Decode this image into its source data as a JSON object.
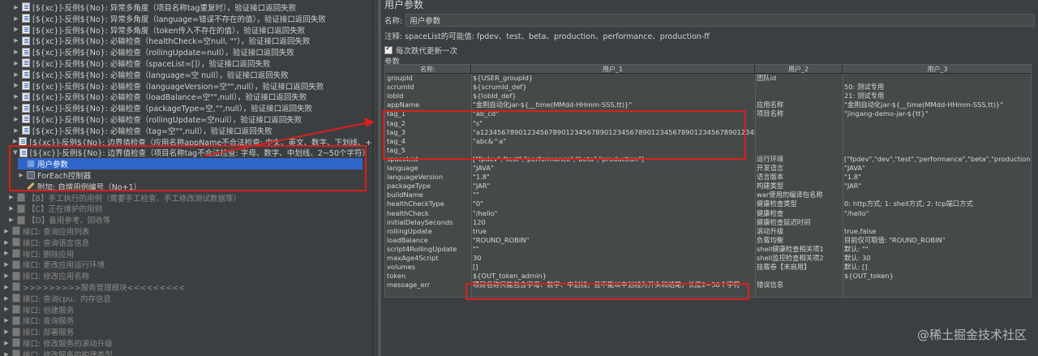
{
  "tree": {
    "items": [
      {
        "text": "[${xc}]-反例${No}: 异常多角度（项目名称tag重复时），验证接口返回失败",
        "kind": "case",
        "disabled": false
      },
      {
        "text": "[${xc}]-反例${No}: 异常多角度（language=错误不存在的值），验证接口返回失败",
        "kind": "case",
        "disabled": false
      },
      {
        "text": "[${xc}]-反例${No}: 异常多角度（token传入不存在的值），验证接口返回失败",
        "kind": "case",
        "disabled": false
      },
      {
        "text": "[${xc}]-反例${No}: 必输检查（healthCheck=空null, \"\"），验证接口返回失败",
        "kind": "case",
        "disabled": false
      },
      {
        "text": "[${xc}]-反例${No}: 必输检查（rollingUpdate=null），验证接口返回失败",
        "kind": "case",
        "disabled": false
      },
      {
        "text": "[${xc}]-反例${No}: 必输检查（spaceList=[]），验证接口返回失败",
        "kind": "case",
        "disabled": false
      },
      {
        "text": "[${xc}]-反例${No}: 必输检查（language=空 null），验证接口返回失败",
        "kind": "case",
        "disabled": false
      },
      {
        "text": "[${xc}]-反例${No}: 必输检查（languageVersion=空\"\",null），验证接口返回失败",
        "kind": "case",
        "disabled": false
      },
      {
        "text": "[${xc}]-反例${No}: 必输检查（loadBalance=空\"\",null），验证接口返回失败",
        "kind": "case",
        "disabled": false
      },
      {
        "text": "[${xc}]-反例${No}: 必输检查（packageType=空,\"\",null），验证接口返回失败",
        "kind": "case",
        "disabled": false
      },
      {
        "text": "[${xc}]-反例${No}: 必输检查（rollingUpdate=空null），验证接口返回失败",
        "kind": "case",
        "disabled": false
      },
      {
        "text": "[${xc}]-反例${No}: 必输检查（tag=空\"\",null），验证接口返回失败",
        "kind": "case",
        "disabled": false
      },
      {
        "text": "[${xc}]-反例${No}: 边界值检查（应用名称appName不合法检查: 中文、英文、数字、下划线、+-",
        "kind": "case",
        "disabled": false
      },
      {
        "text": "[${xc}]-反例${No}: 边界值检查（项目名称tag不合法检查: 字母、数字、中划线、2~50个字符）",
        "kind": "case-open",
        "disabled": false
      },
      {
        "text": "用户参数",
        "kind": "param",
        "disabled": false,
        "selected": true
      },
      {
        "text": "ForEach控制器",
        "kind": "loop",
        "disabled": false
      },
      {
        "text": "附加: 自增用例编号（No+1）",
        "kind": "pen",
        "disabled": false
      },
      {
        "text": "【B】手工执行的用例（需要手工检查、手工修改测试数据等）",
        "kind": "grey",
        "disabled": true
      },
      {
        "text": "【C】正在维护的用例",
        "kind": "grey",
        "disabled": true
      },
      {
        "text": "【D】备用参考、回收等",
        "kind": "grey",
        "disabled": true
      },
      {
        "text": "接口: 查询应用列表",
        "kind": "grey",
        "disabled": true
      },
      {
        "text": "接口: 查询语言信息",
        "kind": "grey",
        "disabled": true
      },
      {
        "text": "接口: 删除应用",
        "kind": "grey",
        "disabled": true
      },
      {
        "text": "接口: 更改应用运行环境",
        "kind": "grey",
        "disabled": true
      },
      {
        "text": "接口: 修改应用名称",
        "kind": "grey",
        "disabled": true
      },
      {
        "text": ">>>>>>>>>服务管理模块<<<<<<<<<",
        "kind": "grey",
        "disabled": true
      },
      {
        "text": "接口: 查询cpu、内存信息",
        "kind": "grey",
        "disabled": true
      },
      {
        "text": "接口: 创建服务",
        "kind": "grey",
        "disabled": true
      },
      {
        "text": "接口: 查询服务",
        "kind": "grey",
        "disabled": true
      },
      {
        "text": "接口: 部署服务",
        "kind": "grey",
        "disabled": true
      },
      {
        "text": "接口: 修改服务的滚动升级",
        "kind": "grey",
        "disabled": true
      },
      {
        "text": "接口: 修改服务的构建类型",
        "kind": "grey",
        "disabled": true
      }
    ]
  },
  "panel": {
    "title": "用户参数",
    "name_label": "名称:",
    "name_value": "用户参数",
    "note": "注释: spaceList的可能值: fpdev、test、beta、production、performance、production-ff",
    "checkbox_label": "每次跌代更新一次",
    "params_label": "参数"
  },
  "table": {
    "headers": [
      "名称:",
      "用户_1",
      "用户_2",
      "用户_3"
    ],
    "rows": [
      [
        "groupId",
        "${USER_groupId}",
        "团队id",
        ""
      ],
      [
        "scrumId",
        "${scrumId_def}",
        "",
        "50: 测试专用"
      ],
      [
        "lobId",
        "${lobId_def}",
        "",
        "21: 测试专用"
      ],
      [
        "appName",
        "\"金刚自动化jar-${__time(MMdd-HHmm-SSS,tt)}\"",
        "应用名称",
        "\"金刚自动化jar-${__time(MMdd-HHmm-SSS,tt)}\""
      ],
      [
        "tag_1",
        "\"ab_cd\"",
        "项目名称",
        "\"jingang-demo-jar-${tt}\""
      ],
      [
        "tag_2",
        "\"s\"",
        "",
        ""
      ],
      [
        "tag_3",
        "\"a123456789012345678901234567890123456789012345678901234567890123456789b\"",
        "",
        ""
      ],
      [
        "tag_4",
        "\"abc&^a\"",
        "",
        ""
      ],
      [
        "tag_5",
        "",
        "",
        ""
      ],
      [
        "spaceList",
        "[\"fpdev\",\"test\",\"performance\",\"beta\",\"production\"]",
        "运行环境",
        "[\"fpdev\",\"dev\",\"test\",\"performance\",\"beta\",\"production\"]"
      ],
      [
        "language",
        "\"JAVA\"",
        "开发语言",
        "\"JAVA\""
      ],
      [
        "languageVersion",
        "\"1.8\"",
        "语言版本",
        "\"1.8\""
      ],
      [
        "packageType",
        "\"JAR\"",
        "构建类型",
        "\"JAR\""
      ],
      [
        "buildName",
        "\"\"",
        "war使用的编译包名称",
        ""
      ],
      [
        "healthCheckType",
        "\"0\"",
        "健康检查类型",
        "0: http方式; 1: shell方式; 2: tcp端口方式"
      ],
      [
        "healthCheck",
        "\"/hello\"",
        "健康检查",
        "\"/hello\""
      ],
      [
        "initialDelaySeconds",
        "120",
        "健康检查延迟时间",
        ""
      ],
      [
        "rollingUpdate",
        "true",
        "滚动升级",
        "true,false"
      ],
      [
        "loadBalance",
        "\"ROUND_ROBIN\"",
        "负载均衡",
        "目前仅可取值: \"ROUND_ROBIN\""
      ],
      [
        "script4RollingUpdate",
        "\"\"",
        "shell健康检查相关项1",
        "默认: \"\""
      ],
      [
        "maxAge4Script",
        "30",
        "shell监控检查相关项2",
        "默认: 30"
      ],
      [
        "volumes",
        "[]",
        "挂载卷【未启用】",
        "默认: []"
      ],
      [
        "token",
        "${OUT_token_admin}",
        "",
        "${OUT_token}"
      ],
      [
        "message_err",
        "项目名称只能包含字母、数字、中划线，且不能以中划线为开头和结尾，长度2~50个字符",
        "错误信息",
        ""
      ]
    ]
  },
  "watermark": "@稀土掘金技术社区",
  "colors": {
    "selection": "#2f65ca",
    "annotation": "#d9201b",
    "background": "#3c3f41"
  }
}
